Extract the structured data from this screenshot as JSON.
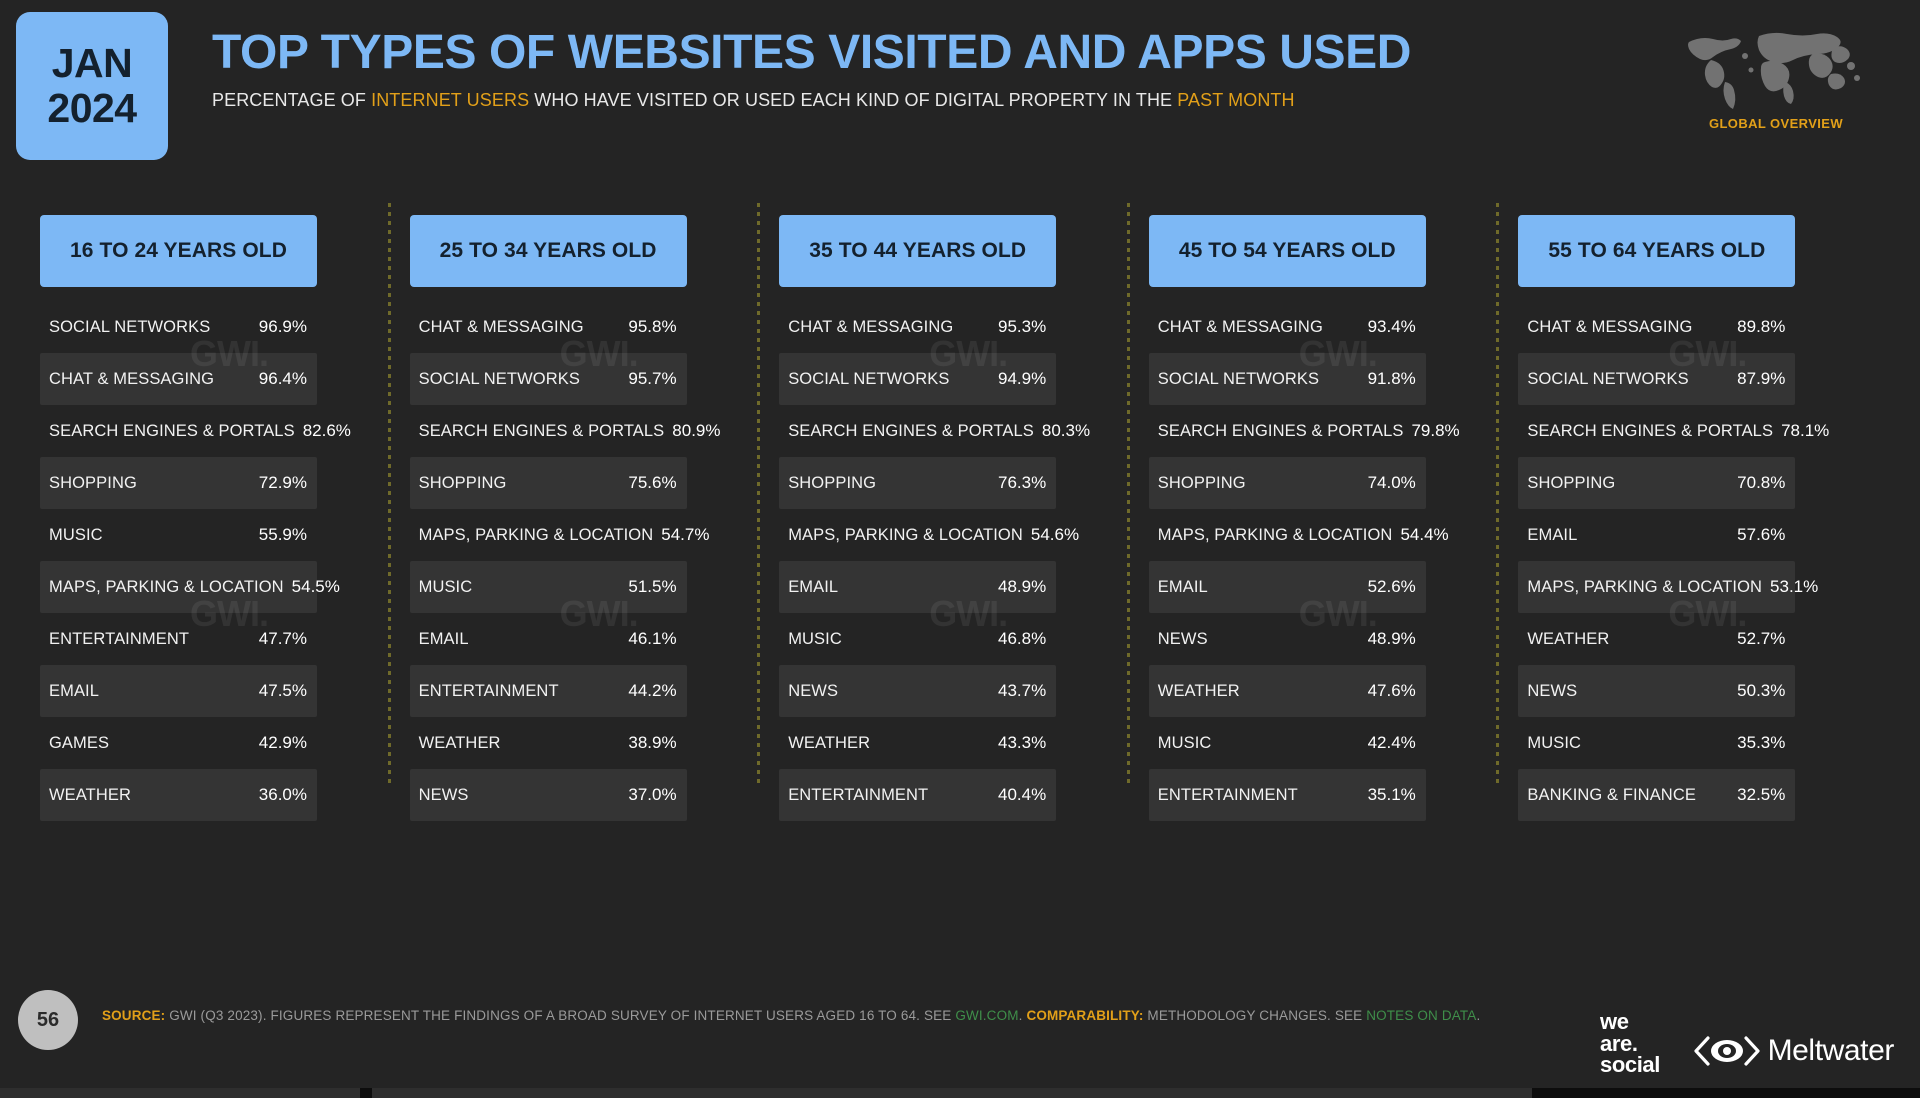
{
  "header": {
    "date_month": "JAN",
    "date_year": "2024",
    "title": "TOP TYPES OF WEBSITES VISITED AND APPS USED",
    "subtitle_part1": "PERCENTAGE OF ",
    "subtitle_hl1": "INTERNET USERS",
    "subtitle_part2": " WHO HAVE VISITED OR USED EACH KIND OF DIGITAL PROPERTY IN THE ",
    "subtitle_hl2": "PAST MONTH",
    "globe_label": "GLOBAL OVERVIEW",
    "accent_blue": "#7db8f5",
    "accent_orange": "#e2a019"
  },
  "watermark": "GWI.",
  "chart_data": {
    "type": "table",
    "title": "TOP TYPES OF WEBSITES VISITED AND APPS USED",
    "subtitle": "PERCENTAGE OF INTERNET USERS WHO HAVE VISITED OR USED EACH KIND OF DIGITAL PROPERTY IN THE PAST MONTH",
    "unit": "%",
    "columns": [
      {
        "header": "16 TO 24 YEARS OLD",
        "rows": [
          {
            "label": "SOCIAL NETWORKS",
            "value": "96.9%"
          },
          {
            "label": "CHAT & MESSAGING",
            "value": "96.4%"
          },
          {
            "label": "SEARCH ENGINES & PORTALS",
            "value": "82.6%"
          },
          {
            "label": "SHOPPING",
            "value": "72.9%"
          },
          {
            "label": "MUSIC",
            "value": "55.9%"
          },
          {
            "label": "MAPS, PARKING & LOCATION",
            "value": "54.5%"
          },
          {
            "label": "ENTERTAINMENT",
            "value": "47.7%"
          },
          {
            "label": "EMAIL",
            "value": "47.5%"
          },
          {
            "label": "GAMES",
            "value": "42.9%"
          },
          {
            "label": "WEATHER",
            "value": "36.0%"
          }
        ]
      },
      {
        "header": "25 TO 34 YEARS OLD",
        "rows": [
          {
            "label": "CHAT & MESSAGING",
            "value": "95.8%"
          },
          {
            "label": "SOCIAL NETWORKS",
            "value": "95.7%"
          },
          {
            "label": "SEARCH ENGINES & PORTALS",
            "value": "80.9%"
          },
          {
            "label": "SHOPPING",
            "value": "75.6%"
          },
          {
            "label": "MAPS, PARKING & LOCATION",
            "value": "54.7%"
          },
          {
            "label": "MUSIC",
            "value": "51.5%"
          },
          {
            "label": "EMAIL",
            "value": "46.1%"
          },
          {
            "label": "ENTERTAINMENT",
            "value": "44.2%"
          },
          {
            "label": "WEATHER",
            "value": "38.9%"
          },
          {
            "label": "NEWS",
            "value": "37.0%"
          }
        ]
      },
      {
        "header": "35 TO 44 YEARS OLD",
        "rows": [
          {
            "label": "CHAT & MESSAGING",
            "value": "95.3%"
          },
          {
            "label": "SOCIAL NETWORKS",
            "value": "94.9%"
          },
          {
            "label": "SEARCH ENGINES & PORTALS",
            "value": "80.3%"
          },
          {
            "label": "SHOPPING",
            "value": "76.3%"
          },
          {
            "label": "MAPS, PARKING & LOCATION",
            "value": "54.6%"
          },
          {
            "label": "EMAIL",
            "value": "48.9%"
          },
          {
            "label": "MUSIC",
            "value": "46.8%"
          },
          {
            "label": "NEWS",
            "value": "43.7%"
          },
          {
            "label": "WEATHER",
            "value": "43.3%"
          },
          {
            "label": "ENTERTAINMENT",
            "value": "40.4%"
          }
        ]
      },
      {
        "header": "45 TO 54 YEARS OLD",
        "rows": [
          {
            "label": "CHAT & MESSAGING",
            "value": "93.4%"
          },
          {
            "label": "SOCIAL NETWORKS",
            "value": "91.8%"
          },
          {
            "label": "SEARCH ENGINES & PORTALS",
            "value": "79.8%"
          },
          {
            "label": "SHOPPING",
            "value": "74.0%"
          },
          {
            "label": "MAPS, PARKING & LOCATION",
            "value": "54.4%"
          },
          {
            "label": "EMAIL",
            "value": "52.6%"
          },
          {
            "label": "NEWS",
            "value": "48.9%"
          },
          {
            "label": "WEATHER",
            "value": "47.6%"
          },
          {
            "label": "MUSIC",
            "value": "42.4%"
          },
          {
            "label": "ENTERTAINMENT",
            "value": "35.1%"
          }
        ]
      },
      {
        "header": "55 TO 64 YEARS OLD",
        "rows": [
          {
            "label": "CHAT & MESSAGING",
            "value": "89.8%"
          },
          {
            "label": "SOCIAL NETWORKS",
            "value": "87.9%"
          },
          {
            "label": "SEARCH ENGINES & PORTALS",
            "value": "78.1%"
          },
          {
            "label": "SHOPPING",
            "value": "70.8%"
          },
          {
            "label": "EMAIL",
            "value": "57.6%"
          },
          {
            "label": "MAPS, PARKING & LOCATION",
            "value": "53.1%"
          },
          {
            "label": "WEATHER",
            "value": "52.7%"
          },
          {
            "label": "NEWS",
            "value": "50.3%"
          },
          {
            "label": "MUSIC",
            "value": "35.3%"
          },
          {
            "label": "BANKING & FINANCE",
            "value": "32.5%"
          }
        ]
      }
    ]
  },
  "footer": {
    "page_number": "56",
    "source_key": "SOURCE:",
    "source_text1": " GWI (Q3 2023). FIGURES REPRESENT THE FINDINGS OF A BROAD SURVEY OF INTERNET USERS AGED 16 TO 64. SEE ",
    "source_link1": "GWI.COM",
    "source_text2": ". ",
    "comparability_key": "COMPARABILITY:",
    "source_text3": " METHODOLOGY CHANGES. SEE ",
    "source_link2": "NOTES ON DATA",
    "source_text4": ".",
    "brand_we": "we",
    "brand_are": "are.",
    "brand_social": "social",
    "meltwater": "Meltwater"
  }
}
